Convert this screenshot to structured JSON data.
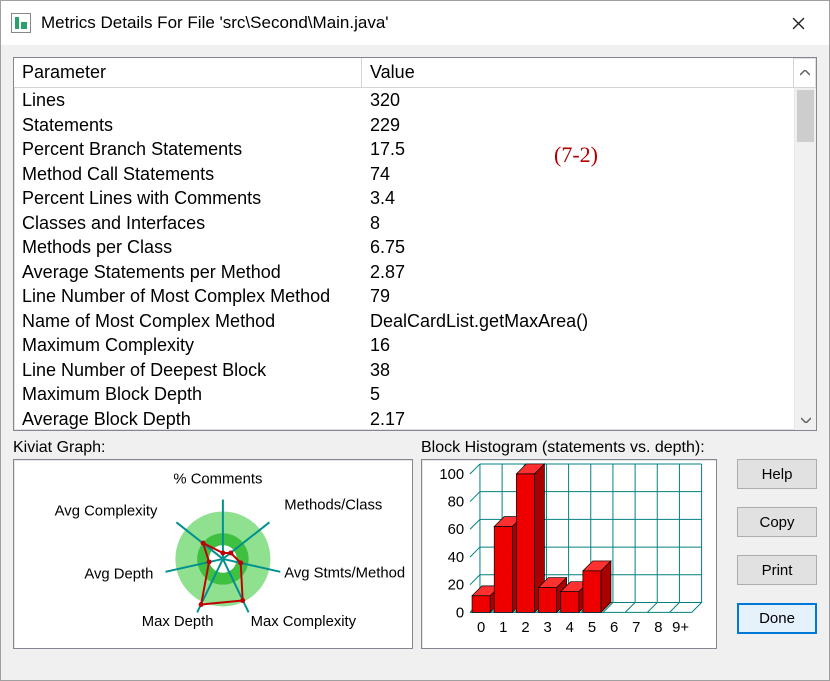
{
  "window": {
    "title": "Metrics Details For File 'src\\Second\\Main.java'"
  },
  "table": {
    "headers": {
      "param": "Parameter",
      "value": "Value"
    },
    "rows": [
      {
        "param": "Lines",
        "value": "320"
      },
      {
        "param": "Statements",
        "value": "229"
      },
      {
        "param": "Percent Branch Statements",
        "value": "17.5"
      },
      {
        "param": "Method Call Statements",
        "value": "74"
      },
      {
        "param": "Percent Lines with Comments",
        "value": "3.4"
      },
      {
        "param": "Classes and Interfaces",
        "value": "8"
      },
      {
        "param": "Methods per Class",
        "value": "6.75"
      },
      {
        "param": "Average Statements per Method",
        "value": "2.87"
      },
      {
        "param": "Line Number of Most Complex Method",
        "value": "79"
      },
      {
        "param": "Name of Most Complex Method",
        "value": "DealCardList.getMaxArea()"
      },
      {
        "param": "Maximum Complexity",
        "value": "16"
      },
      {
        "param": "Line Number of Deepest Block",
        "value": "38"
      },
      {
        "param": "Maximum Block Depth",
        "value": "5"
      },
      {
        "param": "Average Block Depth",
        "value": "2.17"
      }
    ]
  },
  "annotation": "(7-2)",
  "kiviat": {
    "label": "Kiviat Graph:",
    "axes": [
      "% Comments",
      "Methods/Class",
      "Avg Stmts/Method",
      "Max Complexity",
      "Max Depth",
      "Avg Depth",
      "Avg Complexity"
    ]
  },
  "histogram": {
    "label": "Block Histogram (statements vs. depth):"
  },
  "chart_data": {
    "type": "bar",
    "title": "Block Histogram (statements vs. depth)",
    "xlabel": "depth",
    "ylabel": "statements",
    "categories": [
      "0",
      "1",
      "2",
      "3",
      "4",
      "5",
      "6",
      "7",
      "8",
      "9+"
    ],
    "values": [
      12,
      62,
      100,
      18,
      15,
      30,
      0,
      0,
      0,
      0
    ],
    "ylim": [
      0,
      100
    ],
    "yticks": [
      0,
      20,
      40,
      60,
      80,
      100
    ]
  },
  "buttons": {
    "help": "Help",
    "copy": "Copy",
    "print": "Print",
    "done": "Done"
  }
}
